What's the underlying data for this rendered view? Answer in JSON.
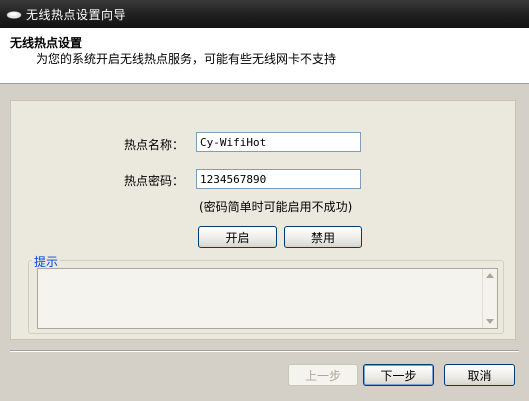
{
  "window": {
    "title": "无线热点设置向导"
  },
  "header": {
    "title": "无线热点设置",
    "subtitle": "为您的系统开启无线热点服务，可能有些无线网卡不支持"
  },
  "form": {
    "ssid_label": "热点名称：",
    "ssid_value": "Cy-WifiHot",
    "password_label": "热点密码：",
    "password_value": "1234567890",
    "password_hint": "(密码简单时可能启用不成功)"
  },
  "actions": {
    "enable": "开启",
    "disable": "禁用"
  },
  "tips": {
    "legend": "提示",
    "text": ""
  },
  "footer": {
    "back": "上一步",
    "next": "下一步",
    "cancel": "取消"
  },
  "colors": {
    "accent": "#0046d5",
    "titlebar": "#1f1f1f"
  }
}
